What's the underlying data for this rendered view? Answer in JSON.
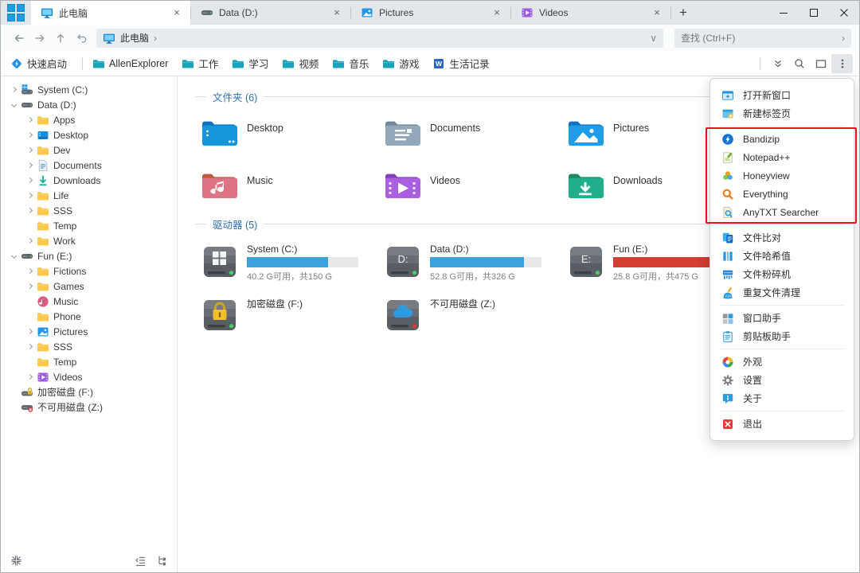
{
  "tabs": [
    {
      "label": "此电脑",
      "icon": "monitor",
      "active": true
    },
    {
      "label": "Data (D:)",
      "icon": "drive",
      "active": false
    },
    {
      "label": "Pictures",
      "icon": "pics",
      "active": false
    },
    {
      "label": "Videos",
      "icon": "vids",
      "active": false
    }
  ],
  "nav": {
    "breadcrumb": {
      "icon": "monitor",
      "label": "此电脑"
    },
    "search_placeholder": "查找 (Ctrl+F)"
  },
  "bookmarks": [
    {
      "label": "快速启动",
      "icon": "quick-launch"
    },
    {
      "label": "AllenExplorer",
      "icon": "bm-folder"
    },
    {
      "label": "工作",
      "icon": "bm-folder"
    },
    {
      "label": "学习",
      "icon": "bm-folder"
    },
    {
      "label": "视频",
      "icon": "bm-folder"
    },
    {
      "label": "音乐",
      "icon": "bm-folder"
    },
    {
      "label": "游戏",
      "icon": "bm-folder"
    },
    {
      "label": "生活记录",
      "icon": "word-doc"
    }
  ],
  "sidebar": {
    "items": [
      {
        "depth": 0,
        "chevron": "right",
        "icon": "drive-win",
        "label": "System (C:)"
      },
      {
        "depth": 0,
        "chevron": "down",
        "icon": "drive",
        "label": "Data (D:)"
      },
      {
        "depth": 1,
        "chevron": "right",
        "icon": "folder",
        "label": "Apps"
      },
      {
        "depth": 1,
        "chevron": "right",
        "icon": "desktop",
        "label": "Desktop"
      },
      {
        "depth": 1,
        "chevron": "right",
        "icon": "folder",
        "label": "Dev"
      },
      {
        "depth": 1,
        "chevron": "right",
        "icon": "doc",
        "label": "Documents"
      },
      {
        "depth": 1,
        "chevron": "right",
        "icon": "download",
        "label": "Downloads"
      },
      {
        "depth": 1,
        "chevron": "right",
        "icon": "folder",
        "label": "Life"
      },
      {
        "depth": 1,
        "chevron": "right",
        "icon": "folder",
        "label": "SSS"
      },
      {
        "depth": 1,
        "chevron": "",
        "icon": "folder",
        "label": "Temp"
      },
      {
        "depth": 1,
        "chevron": "right",
        "icon": "folder",
        "label": "Work"
      },
      {
        "depth": 0,
        "chevron": "down",
        "icon": "drive",
        "label": "Fun (E:)"
      },
      {
        "depth": 1,
        "chevron": "right",
        "icon": "folder",
        "label": "Fictions"
      },
      {
        "depth": 1,
        "chevron": "right",
        "icon": "folder",
        "label": "Games"
      },
      {
        "depth": 1,
        "chevron": "",
        "icon": "music",
        "label": "Music"
      },
      {
        "depth": 1,
        "chevron": "",
        "icon": "folder",
        "label": "Phone"
      },
      {
        "depth": 1,
        "chevron": "right",
        "icon": "pics",
        "label": "Pictures"
      },
      {
        "depth": 1,
        "chevron": "right",
        "icon": "folder",
        "label": "SSS"
      },
      {
        "depth": 1,
        "chevron": "",
        "icon": "folder",
        "label": "Temp"
      },
      {
        "depth": 1,
        "chevron": "right",
        "icon": "vids",
        "label": "Videos"
      },
      {
        "depth": 0,
        "chevron": "",
        "icon": "drive-lock",
        "label": "加密磁盘 (F:)"
      },
      {
        "depth": 0,
        "chevron": "",
        "icon": "drive-err",
        "label": "不可用磁盘 (Z:)"
      }
    ]
  },
  "main": {
    "folders_title": "文件夹 (6)",
    "folders": [
      {
        "label": "Desktop",
        "icon": "tile-desktop"
      },
      {
        "label": "Documents",
        "icon": "tile-documents"
      },
      {
        "label": "Pictures",
        "icon": "tile-pictures"
      },
      {
        "label": "Music",
        "icon": "tile-music"
      },
      {
        "label": "Videos",
        "icon": "tile-videos"
      },
      {
        "label": "Downloads",
        "icon": "tile-downloads"
      }
    ],
    "drives_title": "驱动器 (5)",
    "drives": [
      {
        "label": "System (C:)",
        "icon": "bigdrive-win",
        "bar_percent": 73,
        "bar_color": "#3ba2de",
        "size": "40.2 G可用，共150 G"
      },
      {
        "label": "Data (D:)",
        "icon": "bigdrive-d",
        "bar_percent": 84,
        "bar_color": "#3ba2de",
        "size": "52.8 G可用，共326 G"
      },
      {
        "label": "Fun (E:)",
        "icon": "bigdrive-e",
        "bar_percent": 95,
        "bar_color": "#d53c32",
        "size": "25.8 G可用，共475 G"
      },
      {
        "label": "加密磁盘 (F:)",
        "icon": "bigdrive-lock"
      },
      {
        "label": "不可用磁盘 (Z:)",
        "icon": "bigdrive-cloud"
      }
    ]
  },
  "menu": {
    "accent_red": "#e8141c",
    "groups": [
      {
        "boxed": false,
        "items": [
          {
            "icon": "new-window",
            "label": "打开新窗口"
          },
          {
            "icon": "new-tab",
            "label": "新建标签页"
          }
        ]
      },
      {
        "boxed": true,
        "items": [
          {
            "icon": "bandizip",
            "label": "Bandizip"
          },
          {
            "icon": "notepadpp",
            "label": "Notepad++"
          },
          {
            "icon": "honeyview",
            "label": "Honeyview"
          },
          {
            "icon": "everything",
            "label": "Everything"
          },
          {
            "icon": "anytxt",
            "label": "AnyTXT Searcher"
          }
        ]
      },
      {
        "boxed": false,
        "items": [
          {
            "icon": "file-compare",
            "label": "文件比对"
          },
          {
            "icon": "file-hash",
            "label": "文件哈希值"
          },
          {
            "icon": "file-shredder",
            "label": "文件粉碎机"
          },
          {
            "icon": "dup-clean",
            "label": "重复文件清理"
          }
        ]
      },
      {
        "boxed": false,
        "items": [
          {
            "icon": "window-helper",
            "label": "窗口助手"
          },
          {
            "icon": "clipboard",
            "label": "剪贴板助手"
          }
        ]
      },
      {
        "boxed": false,
        "items": [
          {
            "icon": "appearance",
            "label": "外观"
          },
          {
            "icon": "settings",
            "label": "设置"
          },
          {
            "icon": "about",
            "label": "关于"
          }
        ]
      },
      {
        "boxed": false,
        "items": [
          {
            "icon": "exit",
            "label": "退出"
          }
        ]
      }
    ]
  }
}
